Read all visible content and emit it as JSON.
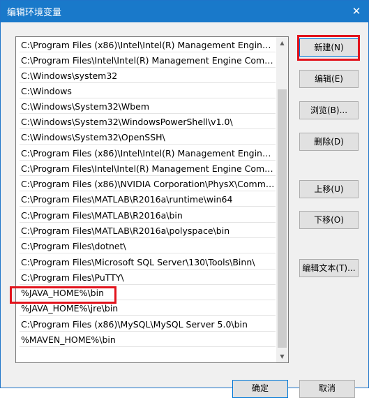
{
  "window": {
    "title": "编辑环境变量",
    "close_icon": "close-icon"
  },
  "path_list": {
    "items": [
      "C:\\Program Files (x86)\\Intel\\Intel(R) Management Engine Co...",
      "C:\\Program Files\\Intel\\Intel(R) Management Engine Compon...",
      "C:\\Windows\\system32",
      "C:\\Windows",
      "C:\\Windows\\System32\\Wbem",
      "C:\\Windows\\System32\\WindowsPowerShell\\v1.0\\",
      "C:\\Windows\\System32\\OpenSSH\\",
      "C:\\Program Files (x86)\\Intel\\Intel(R) Management Engine Co...",
      "C:\\Program Files\\Intel\\Intel(R) Management Engine Compon...",
      "C:\\Program Files (x86)\\NVIDIA Corporation\\PhysX\\Common",
      "C:\\Program Files\\MATLAB\\R2016a\\runtime\\win64",
      "C:\\Program Files\\MATLAB\\R2016a\\bin",
      "C:\\Program Files\\MATLAB\\R2016a\\polyspace\\bin",
      "C:\\Program Files\\dotnet\\",
      "C:\\Program Files\\Microsoft SQL Server\\130\\Tools\\Binn\\",
      "C:\\Program Files\\PuTTY\\",
      "%JAVA_HOME%\\bin",
      "%JAVA_HOME%\\jre\\bin",
      "C:\\Program Files (x86)\\MySQL\\MySQL Server 5.0\\bin",
      "%MAVEN_HOME%\\bin"
    ]
  },
  "buttons": {
    "new": "新建(N)",
    "edit": "编辑(E)",
    "browse": "浏览(B)...",
    "delete": "删除(D)",
    "move_up": "上移(U)",
    "move_down": "下移(O)",
    "edit_text": "编辑文本(T)..."
  },
  "footer": {
    "ok": "确定",
    "cancel": "取消"
  },
  "colors": {
    "titlebar": "#1979ca",
    "highlight": "#e2131c"
  }
}
